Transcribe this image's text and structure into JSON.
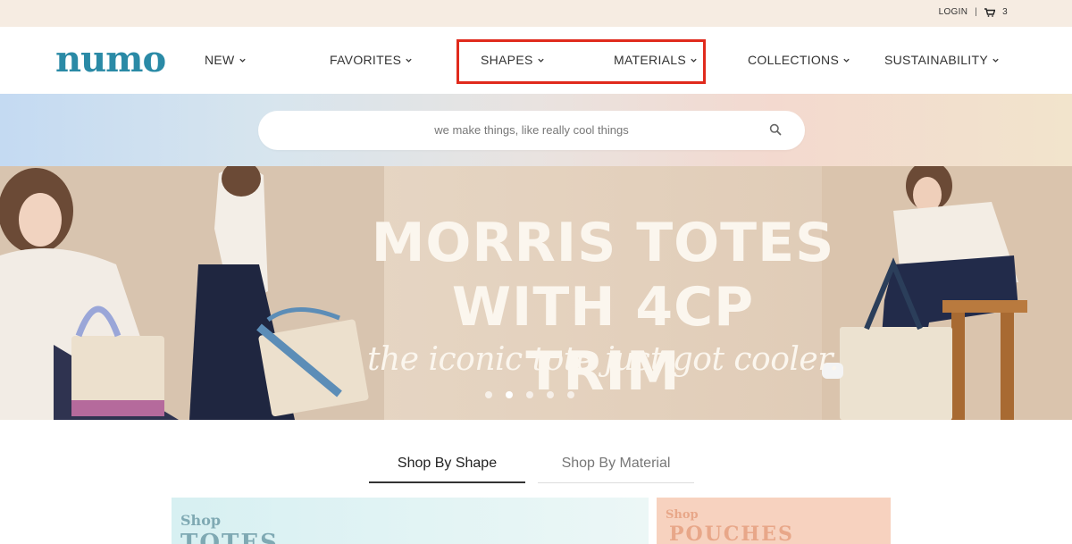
{
  "topbar": {
    "login": "LOGIN",
    "separator": "|",
    "cart_count": "3"
  },
  "logo": {
    "text": "numo"
  },
  "nav": {
    "items": [
      {
        "label": "NEW"
      },
      {
        "label": "FAVORITES"
      },
      {
        "label": "SHAPES"
      },
      {
        "label": "MATERIALS"
      },
      {
        "label": "COLLECTIONS"
      },
      {
        "label": "SUSTAINABILITY"
      }
    ]
  },
  "search": {
    "placeholder": "we make things, like really cool things"
  },
  "hero": {
    "title_line1": "MORRIS TOTES",
    "title_line2": "WITH 4CP TRIM",
    "subtitle": "the iconic tote just got cooler.",
    "slide_count": 5,
    "active_slide": 2
  },
  "tabs": [
    {
      "label": "Shop By Shape",
      "active": true
    },
    {
      "label": "Shop By Material",
      "active": false
    }
  ],
  "cards": [
    {
      "shop": "Shop",
      "name": "TOTES"
    },
    {
      "shop": "Shop",
      "name": "POUCHES"
    }
  ],
  "colors": {
    "brand": "#2a8aa6",
    "highlight": "#e02a1c",
    "topbar_bg": "#f6ece2"
  }
}
